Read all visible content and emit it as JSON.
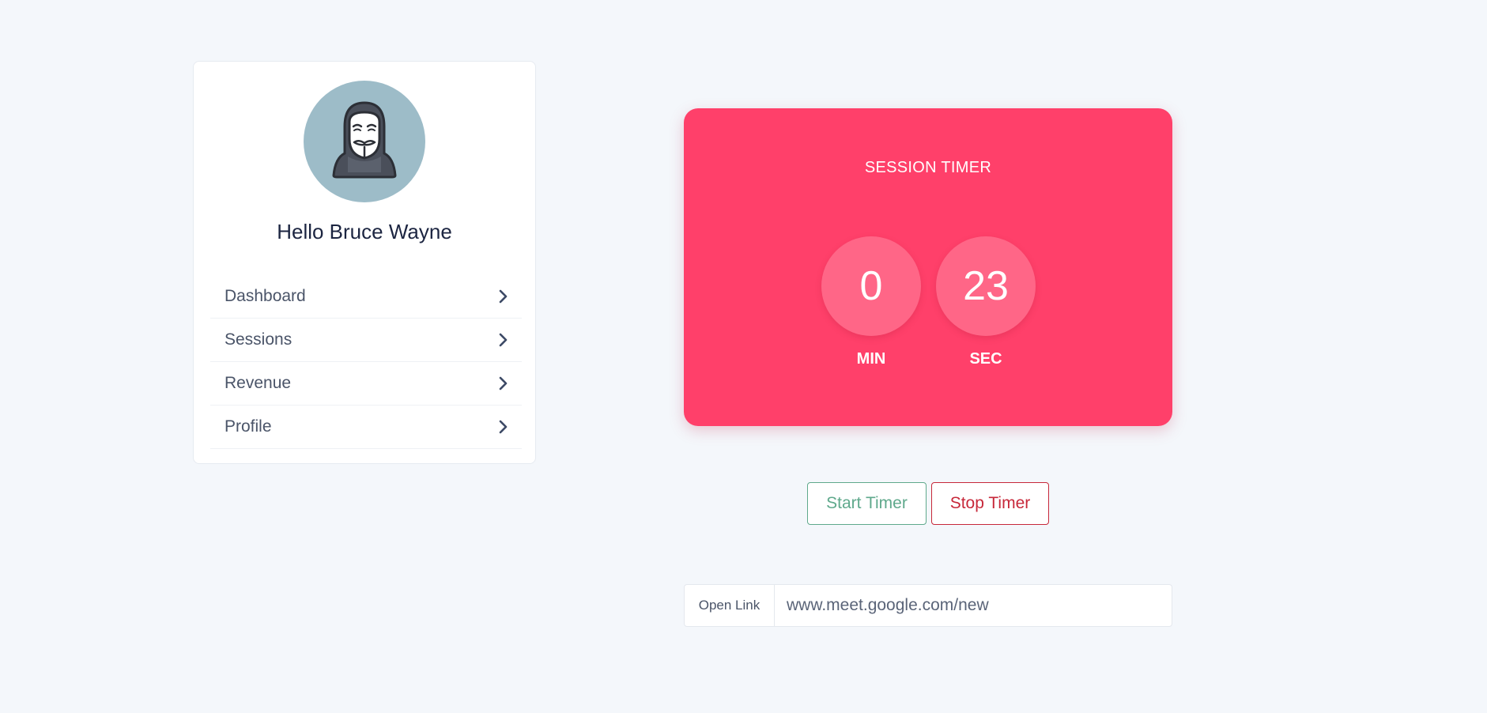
{
  "profile": {
    "greeting": "Hello Bruce Wayne",
    "avatar_icon": "anonymous-mask-avatar",
    "avatar_bg": "#9dbcc8"
  },
  "menu": {
    "items": [
      {
        "label": "Dashboard",
        "icon": "chevron-right-icon"
      },
      {
        "label": "Sessions",
        "icon": "chevron-right-icon"
      },
      {
        "label": "Revenue",
        "icon": "chevron-right-icon"
      },
      {
        "label": "Profile",
        "icon": "chevron-right-icon"
      }
    ]
  },
  "timer": {
    "title": "SESSION TIMER",
    "minutes": "0",
    "seconds": "23",
    "min_label": "MIN",
    "sec_label": "SEC",
    "bg_color": "#ff406a"
  },
  "controls": {
    "start_label": "Start Timer",
    "stop_label": "Stop Timer",
    "start_color": "#5fa98c",
    "stop_color": "#c7283a"
  },
  "link": {
    "addon_label": "Open Link",
    "value": "www.meet.google.com/new"
  }
}
